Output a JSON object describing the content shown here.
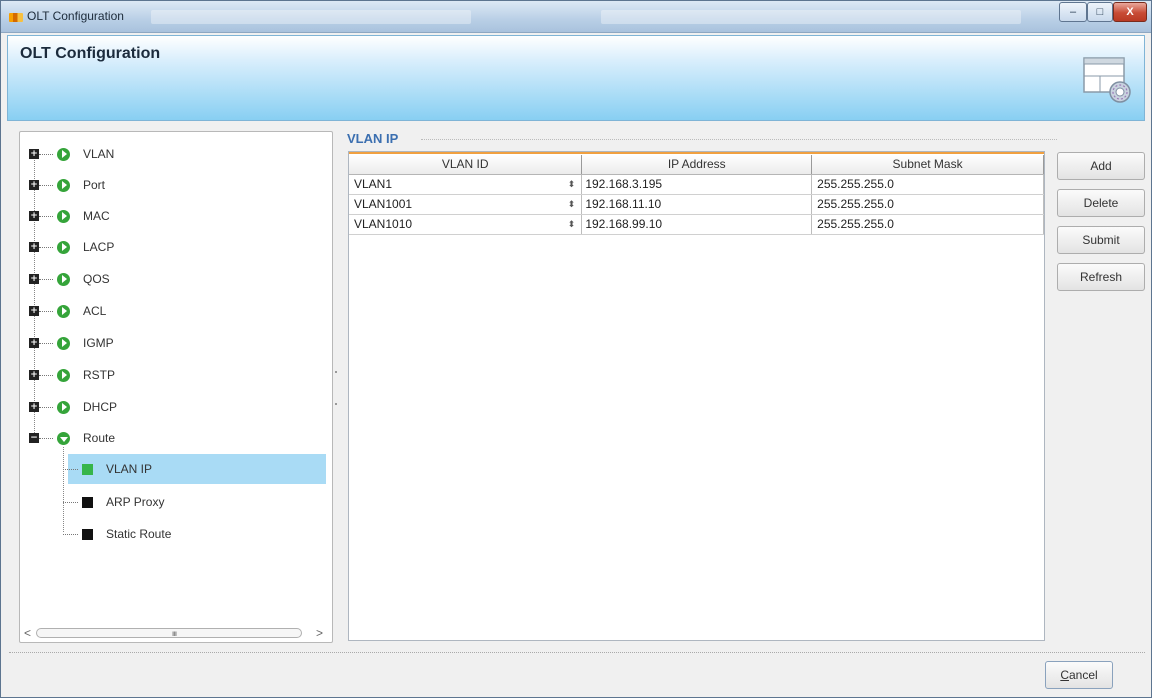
{
  "window": {
    "title": "OLT Configuration",
    "controls": {
      "minimize": "–",
      "maximize": "□",
      "close": "X"
    }
  },
  "banner": {
    "title": "OLT Configuration"
  },
  "tree": {
    "items": [
      {
        "label": "VLAN",
        "expander": "+"
      },
      {
        "label": "Port",
        "expander": "+"
      },
      {
        "label": "MAC",
        "expander": "+"
      },
      {
        "label": "LACP",
        "expander": "+"
      },
      {
        "label": "QOS",
        "expander": "+"
      },
      {
        "label": "ACL",
        "expander": "+"
      },
      {
        "label": "IGMP",
        "expander": "+"
      },
      {
        "label": "RSTP",
        "expander": "+"
      },
      {
        "label": "DHCP",
        "expander": "+"
      },
      {
        "label": "Route",
        "expander": "−"
      }
    ],
    "children": [
      {
        "label": "VLAN IP",
        "selected": true
      },
      {
        "label": "ARP Proxy",
        "selected": false
      },
      {
        "label": "Static Route",
        "selected": false
      }
    ],
    "scroll": {
      "left": "<",
      "right": ">",
      "grip": "IIIIII"
    }
  },
  "section": {
    "title": "VLAN IP"
  },
  "table": {
    "columns": [
      "VLAN ID",
      "IP Address",
      "Subnet Mask"
    ],
    "rows": [
      {
        "vlan": "VLAN1",
        "ip": "192.168.3.195",
        "mask": "255.255.255.0"
      },
      {
        "vlan": "VLAN1001",
        "ip": "192.168.11.10",
        "mask": "255.255.255.0"
      },
      {
        "vlan": "VLAN1010",
        "ip": "192.168.99.10",
        "mask": "255.255.255.0"
      }
    ],
    "spinner_glyph": "⬍"
  },
  "actions": {
    "add": "Add",
    "delete": "Delete",
    "submit": "Submit",
    "refresh": "Refresh"
  },
  "footer": {
    "cancel_prefix": "C",
    "cancel_rest": "ancel"
  },
  "colors": {
    "accent": "#3b6fb0",
    "selection": "#a9dbf5",
    "node_icon": "#35a43a",
    "table_accent": "#f0a040"
  }
}
